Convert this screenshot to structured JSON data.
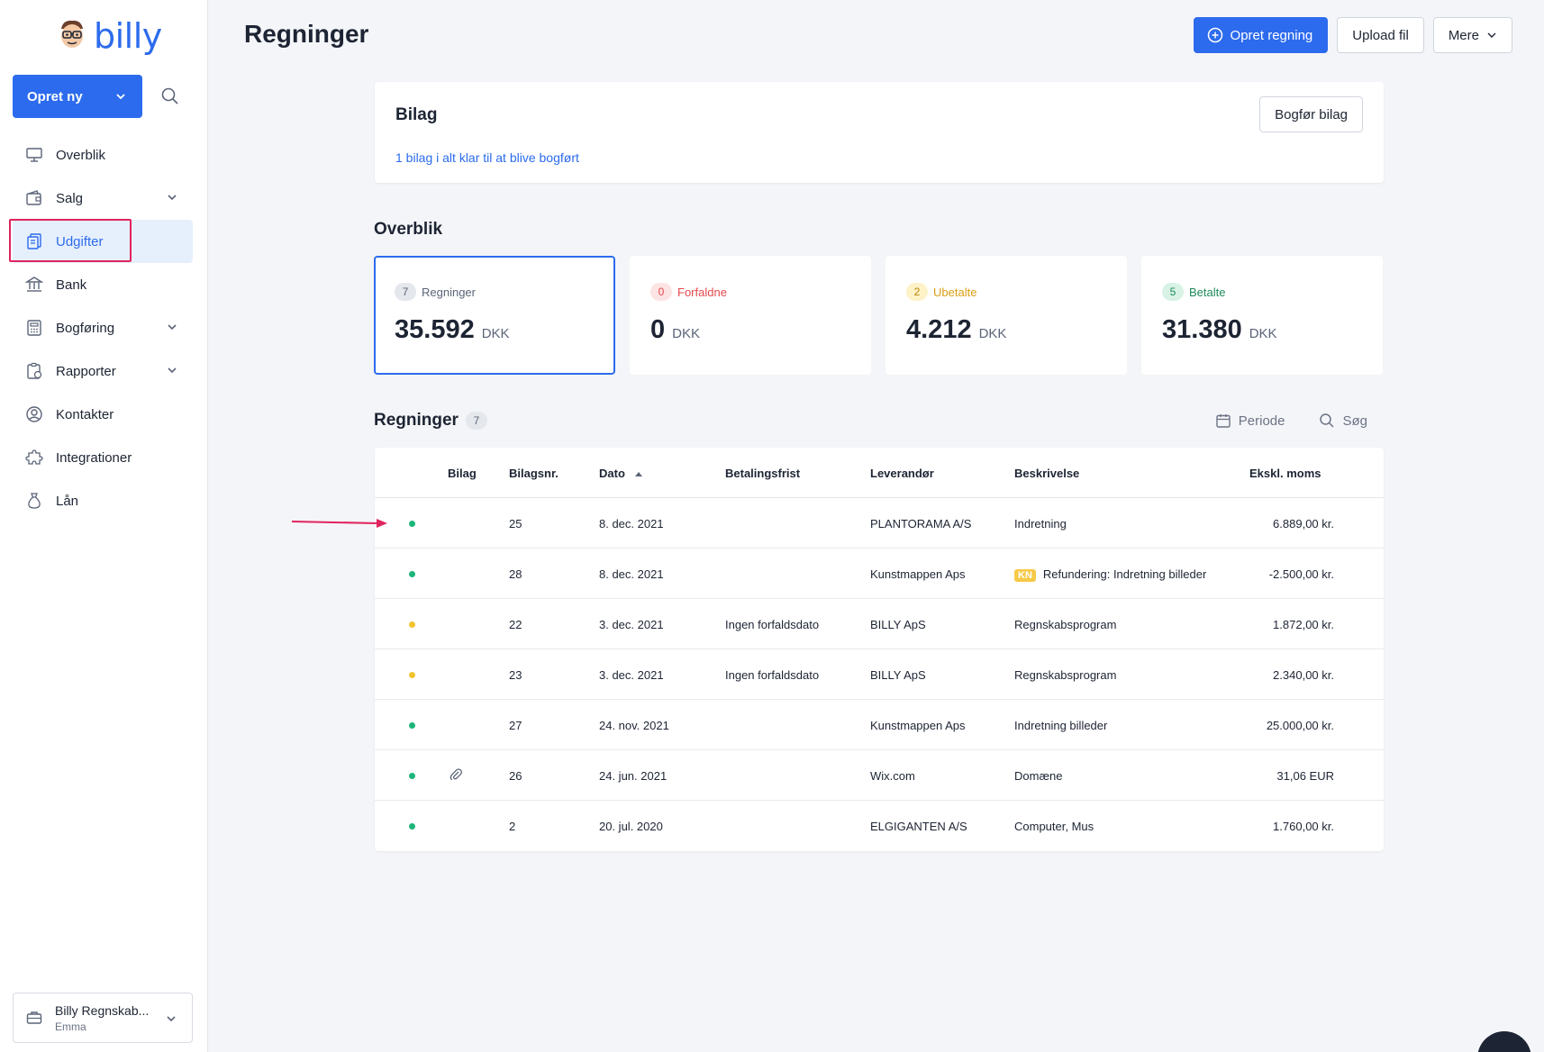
{
  "app": {
    "logo_text": "billy",
    "create_label": "Opret ny"
  },
  "sidebar": {
    "items": [
      {
        "label": "Overblik",
        "icon": "presentation-icon"
      },
      {
        "label": "Salg",
        "icon": "wallet-icon",
        "expandable": true
      },
      {
        "label": "Udgifter",
        "icon": "receipts-icon",
        "active": true
      },
      {
        "label": "Bank",
        "icon": "bank-icon"
      },
      {
        "label": "Bogføring",
        "icon": "calculator-icon",
        "expandable": true
      },
      {
        "label": "Rapporter",
        "icon": "report-icon",
        "expandable": true
      },
      {
        "label": "Kontakter",
        "icon": "contact-icon"
      },
      {
        "label": "Integrationer",
        "icon": "puzzle-icon"
      },
      {
        "label": "Lån",
        "icon": "money-bag-icon"
      }
    ],
    "org": {
      "name": "Billy Regnskab...",
      "user": "Emma"
    }
  },
  "header": {
    "title": "Regninger",
    "create_bill_label": "Opret regning",
    "upload_label": "Upload fil",
    "more_label": "Mere"
  },
  "bilag": {
    "title": "Bilag",
    "link": "1 bilag i alt klar til at blive bogført",
    "button": "Bogfør bilag"
  },
  "overview": {
    "title": "Overblik",
    "cards": [
      {
        "count": "7",
        "label": "Regninger",
        "value": "35.592",
        "currency": "DKK",
        "color": "#5b6478",
        "pill_bg": "#e4e7ec",
        "pill_color": "#5b6478"
      },
      {
        "count": "0",
        "label": "Forfaldne",
        "value": "0",
        "currency": "DKK",
        "color": "#e5484d",
        "pill_bg": "#fde4e4",
        "pill_color": "#e5484d"
      },
      {
        "count": "2",
        "label": "Ubetalte",
        "value": "4.212",
        "currency": "DKK",
        "color": "#d89e12",
        "pill_bg": "#fdf2c8",
        "pill_color": "#b88400"
      },
      {
        "count": "5",
        "label": "Betalte",
        "value": "31.380",
        "currency": "DKK",
        "color": "#1f8a5b",
        "pill_bg": "#d8f3e5",
        "pill_color": "#1f8a5b"
      }
    ]
  },
  "list": {
    "title": "Regninger",
    "count": "7",
    "period_label": "Periode",
    "search_label": "Søg",
    "columns": [
      "Bilag",
      "Bilagsnr.",
      "Dato",
      "Betalingsfrist",
      "Leverandør",
      "Beskrivelse",
      "Ekskl. moms"
    ],
    "rows": [
      {
        "status": "green",
        "attachment": false,
        "nr": "25",
        "date": "8. dec. 2021",
        "due": "",
        "vendor": "PLANTORAMA A/S",
        "badge": "",
        "desc": "Indretning",
        "amount": "6.889,00 kr."
      },
      {
        "status": "green",
        "attachment": false,
        "nr": "28",
        "date": "8. dec. 2021",
        "due": "",
        "vendor": "Kunstmappen Aps",
        "badge": "KN",
        "desc": "Refundering: Indretning billeder",
        "amount": "-2.500,00 kr."
      },
      {
        "status": "yellow",
        "attachment": false,
        "nr": "22",
        "date": "3. dec. 2021",
        "due": "Ingen forfaldsdato",
        "vendor": "BILLY ApS",
        "badge": "",
        "desc": "Regnskabsprogram",
        "amount": "1.872,00 kr."
      },
      {
        "status": "yellow",
        "attachment": false,
        "nr": "23",
        "date": "3. dec. 2021",
        "due": "Ingen forfaldsdato",
        "vendor": "BILLY ApS",
        "badge": "",
        "desc": "Regnskabsprogram",
        "amount": "2.340,00 kr."
      },
      {
        "status": "green",
        "attachment": false,
        "nr": "27",
        "date": "24. nov. 2021",
        "due": "",
        "vendor": "Kunstmappen Aps",
        "badge": "",
        "desc": "Indretning billeder",
        "amount": "25.000,00 kr."
      },
      {
        "status": "green",
        "attachment": true,
        "nr": "26",
        "date": "24. jun. 2021",
        "due": "",
        "vendor": "Wix.com",
        "badge": "",
        "desc": "Domæne",
        "amount": "31,06 EUR"
      },
      {
        "status": "green",
        "attachment": false,
        "nr": "2",
        "date": "20. jul. 2020",
        "due": "",
        "vendor": "ELGIGANTEN A/S",
        "badge": "",
        "desc": "Computer, Mus",
        "amount": "1.760,00 kr."
      }
    ]
  },
  "colors": {
    "accent": "#2c6bed",
    "status_green": "#1db57a",
    "status_yellow": "#f2c230",
    "annotation_red": "#e0245e"
  }
}
